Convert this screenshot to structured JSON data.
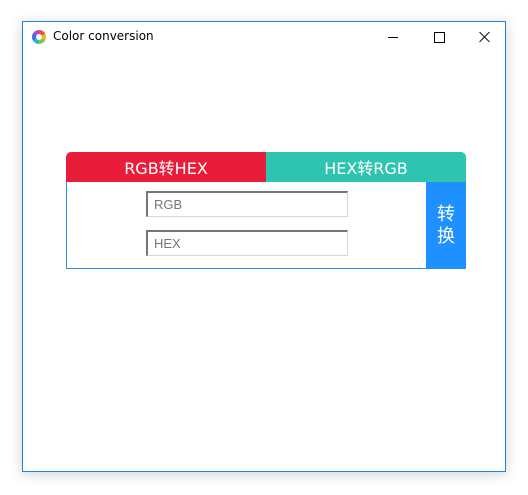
{
  "window": {
    "title": "Color conversion"
  },
  "tabs": {
    "rgb_to_hex": "RGB转HEX",
    "hex_to_rgb": "HEX转RGB"
  },
  "fields": {
    "rgb_placeholder": "RGB",
    "hex_placeholder": "HEX",
    "rgb_value": "",
    "hex_value": ""
  },
  "convert_button": {
    "line1": "转",
    "line2": "换"
  },
  "colors": {
    "tab_rgb_to_hex": "#e81d3a",
    "tab_hex_to_rgb": "#2ec4b0",
    "convert_button": "#1e90ff",
    "panel_border": "#2190ee",
    "window_border": "#1e88d8"
  },
  "icons": {
    "app": "color-wheel-icon",
    "minimize": "minimize-icon",
    "maximize": "maximize-icon",
    "close": "close-icon"
  }
}
